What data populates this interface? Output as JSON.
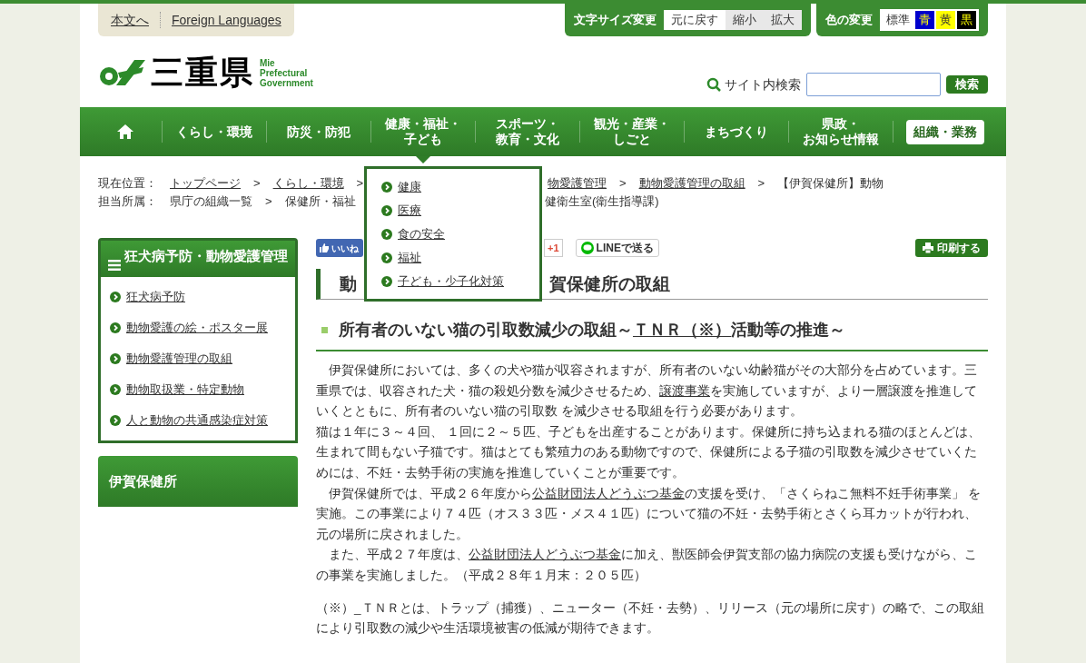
{
  "header_links": [
    "本文へ",
    "Foreign Languages"
  ],
  "font_size": {
    "label": "文字サイズ変更",
    "options": [
      {
        "label": "元に戻す",
        "selected": true
      },
      {
        "label": "縮小",
        "selected": false
      },
      {
        "label": "拡大",
        "selected": false
      }
    ]
  },
  "color_change": {
    "label": "色の変更",
    "options": [
      {
        "label": "標準",
        "color": "#ffffff"
      },
      {
        "label": "青",
        "color": "#0000cc"
      },
      {
        "label": "黄",
        "color": "#ffff00"
      },
      {
        "label": "黒",
        "color": "#000000"
      }
    ]
  },
  "logo": {
    "name": "三重県",
    "subtitle": [
      "Mie",
      "Prefectural",
      "Government"
    ]
  },
  "search": {
    "label": "サイト内検索",
    "button": "検索"
  },
  "nav": [
    {
      "kind": "home"
    },
    {
      "kind": "link",
      "label": [
        "くらし・環境"
      ]
    },
    {
      "kind": "link",
      "label": [
        "防災・防犯"
      ]
    },
    {
      "kind": "link",
      "label": [
        "健康・福祉・",
        "子ども"
      ],
      "expanded": true,
      "submenu": [
        "健康",
        "医療",
        "食の安全",
        "福祉",
        "子ども・少子化対策"
      ]
    },
    {
      "kind": "link",
      "label": [
        "スポーツ・",
        "教育・文化"
      ]
    },
    {
      "kind": "link",
      "label": [
        "観光・産業・",
        "しごと"
      ]
    },
    {
      "kind": "link",
      "label": [
        "まちづくり"
      ]
    },
    {
      "kind": "link",
      "label": [
        "県政・",
        "お知らせ情報"
      ]
    },
    {
      "kind": "button",
      "label": [
        "組織・業務"
      ]
    }
  ],
  "breadcrumb": {
    "left": [
      {
        "text": "現在位置：",
        "link": false
      },
      {
        "text": "トップページ",
        "link": true
      },
      {
        "text": ">",
        "link": false
      },
      {
        "text": "くらし・環境",
        "link": true
      },
      {
        "text": ">",
        "link": false
      }
    ],
    "right": [
      {
        "text": "物愛護管理",
        "link": true
      },
      {
        "text": ">",
        "link": false
      },
      {
        "text": "動物愛護管理の取組",
        "link": true
      },
      {
        "text": ">",
        "link": false
      },
      {
        "text": "【伊賀保健所】動物",
        "link": false
      }
    ]
  },
  "department": {
    "left": [
      {
        "text": "担当所属：",
        "link": false
      },
      {
        "text": "県庁の組織一覧",
        "link": false
      },
      {
        "text": ">",
        "link": false
      },
      {
        "text": "保健所・福祉",
        "link": false
      }
    ],
    "right": [
      {
        "text": "健衛生室(衛生指導課)",
        "link": false
      }
    ]
  },
  "sidebar": {
    "title": "狂犬病予防・動物愛護管理",
    "items": [
      "狂犬病予防",
      "動物愛護の絵・ポスター展",
      "動物愛護管理の取組",
      "動物取扱業・特定動物",
      "人と動物の共通感染症対策"
    ],
    "office": "伊賀保健所"
  },
  "share": {
    "facebook": "いいね",
    "gplus": "+1",
    "line": "LINEで送る",
    "print": "印刷する"
  },
  "page_title": {
    "left": "動",
    "right": "賀保健所の取組"
  },
  "section_heading": [
    {
      "text": "所有者のいない猫の引取数減少の取組～",
      "link": false
    },
    {
      "text": "ＴＮＲ（※）",
      "link": true
    },
    {
      "text": "活動等の推進～",
      "link": false
    }
  ],
  "paragraphs": [
    {
      "kind": "body",
      "segments": [
        {
          "text": "　伊賀保健所においては、多くの犬や猫が収容されますが、所有者のいない幼齢猫がその大部分を占めています。三重県では、収容された犬・猫の殺処分数を減少させるため、",
          "link": false
        },
        {
          "text": "譲渡事業",
          "link": true
        },
        {
          "text": "を実施していますが、より一層譲渡を推進していくとともに、所有者のいない猫の引取数 を減少させる取組を行う必要があります。",
          "link": false
        }
      ]
    },
    {
      "kind": "body",
      "segments": [
        {
          "text": "猫は１年に３～４回、 １回に２～５匹、子どもを出産することがあります。保健所に持ち込まれる猫のほとんどは、生まれて間もない子猫です。猫はとても繁殖力のある動物ですので、保健所による子猫の引取数を減少させていくためには、不妊・去勢手術の実施を推進していくことが重要です。",
          "link": false
        }
      ]
    },
    {
      "kind": "body",
      "segments": [
        {
          "text": "　伊賀保健所では、平成２６年度から",
          "link": false
        },
        {
          "text": "公益財団法人どうぶつ基金",
          "link": true
        },
        {
          "text": "の支援を受け、「さくらねこ無料不妊手術事業」 を実施。この事業により７４匹（オス３３匹・メス４１匹）について猫の不妊・去勢手術とさくら耳カットが行われ、元の場所に戻されました。",
          "link": false
        }
      ]
    },
    {
      "kind": "body",
      "segments": [
        {
          "text": "　また、平成２７年度は、",
          "link": false
        },
        {
          "text": "公益財団法人どうぶつ基金",
          "link": true
        },
        {
          "text": "に加え、獣医師会伊賀支部の協力病院の支援も受けながら、この事業を実施しました。（平成２８年１月末：２０５匹）",
          "link": false
        }
      ]
    },
    {
      "kind": "note",
      "segments": [
        {
          "text": "（※）_ＴＮＲとは、トラップ（捕獲）、ニューター（不妊・去勢）、リリース（元の場所に戻す）の略で、この取組により引取数の減少や生活環境被害の低減が期待できます。",
          "link": false
        }
      ]
    }
  ]
}
